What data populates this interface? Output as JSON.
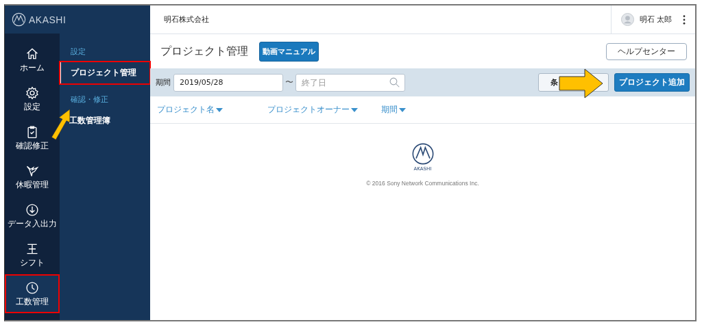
{
  "brand": {
    "name": "AKASHI"
  },
  "rail": [
    {
      "kind": "home",
      "label": "ホーム",
      "selected": false,
      "highlighted": false
    },
    {
      "kind": "gear",
      "label": "設定",
      "selected": false,
      "highlighted": false
    },
    {
      "kind": "clipboard",
      "label": "確認修正",
      "selected": false,
      "highlighted": false
    },
    {
      "kind": "bird",
      "label": "休暇管理",
      "selected": false,
      "highlighted": false
    },
    {
      "kind": "download",
      "label": "データ入出力",
      "selected": false,
      "highlighted": false
    },
    {
      "kind": "shift",
      "label": "シフト",
      "selected": false,
      "highlighted": false
    },
    {
      "kind": "clock",
      "label": "工数管理",
      "selected": true,
      "highlighted": true
    }
  ],
  "submenu": {
    "pointer_arrow": true,
    "sections": [
      {
        "heading": "設定",
        "items": [
          {
            "label": "プロジェクト管理",
            "selected": true,
            "highlighted": true
          }
        ]
      },
      {
        "heading": "確認・修正",
        "items": [
          {
            "label": "工数管理簿",
            "selected": false,
            "highlighted": false
          }
        ]
      }
    ]
  },
  "header": {
    "company": "明石株式会社",
    "user": "明石 太郎"
  },
  "page": {
    "title": "プロジェクト管理",
    "video_button": "動画マニュアル",
    "help_button": "ヘルプセンター"
  },
  "filter": {
    "label": "期間",
    "start": "2019/05/28",
    "separator": "〜",
    "end_placeholder": "終了日",
    "conditions_button": "条",
    "add_button": "プロジェクト追加",
    "pointer_arrow": true
  },
  "sort_columns": [
    {
      "label": "プロジェクト名"
    },
    {
      "label": "プロジェクトオーナー"
    },
    {
      "label": "期間"
    }
  ],
  "footer": {
    "logo_text": "AKASHI",
    "copyright": "© 2016 Sony Network Communications Inc."
  }
}
